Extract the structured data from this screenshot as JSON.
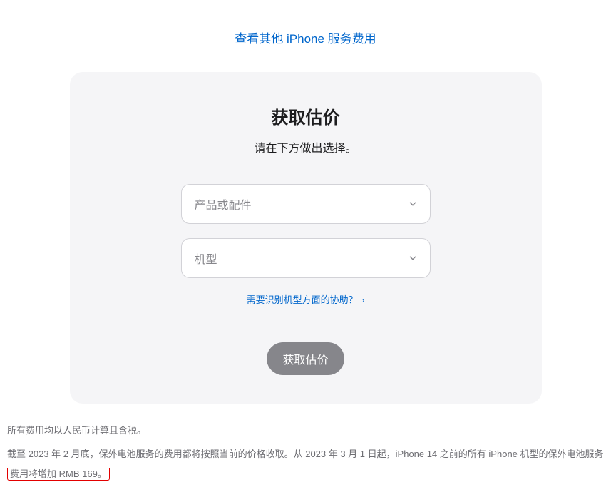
{
  "topLink": "查看其他 iPhone 服务费用",
  "card": {
    "title": "获取估价",
    "subtitle": "请在下方做出选择。",
    "select1": {
      "placeholder": "产品或配件"
    },
    "select2": {
      "placeholder": "机型"
    },
    "helpLink": "需要识别机型方面的协助？",
    "helpArrow": "›",
    "button": "获取估价"
  },
  "footer": {
    "line1": "所有费用均以人民币计算且含税。",
    "line2_part1": "截至 2023 年 2 月底，保外电池服务的费用都将按照当前的价格收取。从 2023 年 3 月 1 日起，iPhone 14 之前的所有 iPhone 机型的保外电池服务",
    "line2_highlight": "费用将增加 RMB 169。"
  }
}
